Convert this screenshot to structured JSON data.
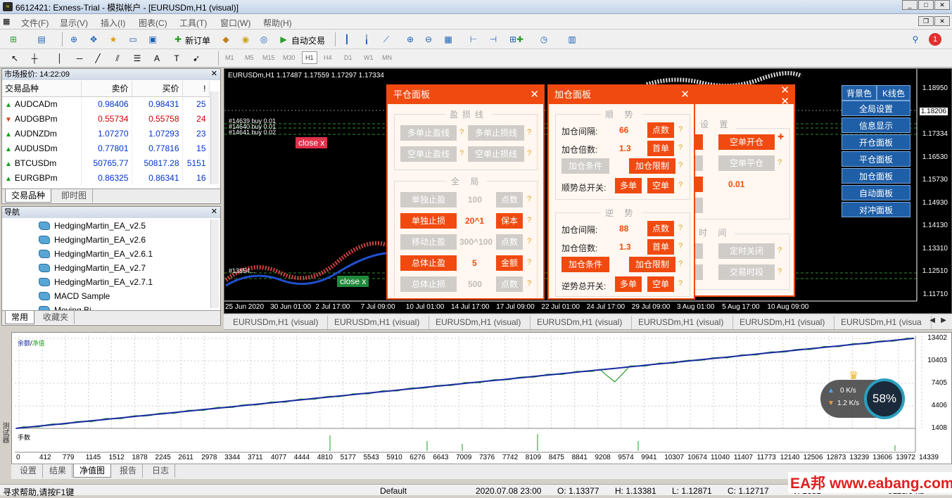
{
  "window": {
    "title": "6612421: Exness-Trial - 模拟帐户 - [EURUSDm,H1 (visual)]"
  },
  "menu": [
    "文件(F)",
    "显示(V)",
    "插入(I)",
    "图表(C)",
    "工具(T)",
    "窗口(W)",
    "帮助(H)"
  ],
  "toolbar": {
    "new_order": "新订单",
    "auto_trade": "自动交易",
    "timeframes": [
      "M1",
      "M5",
      "M15",
      "M30",
      "H1",
      "H4",
      "D1",
      "W1",
      "MN"
    ],
    "active_tf": "H1",
    "notif_count": "1"
  },
  "market_watch": {
    "title": "市场报价: 14:22:09",
    "cols": [
      "交易品种",
      "卖价",
      "买价",
      "!"
    ],
    "rows": [
      {
        "sym": "AUDCADm",
        "bid": "0.98406",
        "ask": "0.98431",
        "sp": "25",
        "color": "#0033cc",
        "dir": "up"
      },
      {
        "sym": "AUDGBPm",
        "bid": "0.55734",
        "ask": "0.55758",
        "sp": "24",
        "color": "#cc0000",
        "dir": "down"
      },
      {
        "sym": "AUDNZDm",
        "bid": "1.07270",
        "ask": "1.07293",
        "sp": "23",
        "color": "#0033cc",
        "dir": "up"
      },
      {
        "sym": "AUDUSDm",
        "bid": "0.77801",
        "ask": "0.77816",
        "sp": "15",
        "color": "#0033cc",
        "dir": "up"
      },
      {
        "sym": "BTCUSDm",
        "bid": "50765.77",
        "ask": "50817.28",
        "sp": "5151",
        "color": "#0033cc",
        "dir": "up"
      },
      {
        "sym": "EURGBPm",
        "bid": "0.86325",
        "ask": "0.86341",
        "sp": "16",
        "color": "#0033cc",
        "dir": "up"
      }
    ],
    "tabs": [
      "交易品种",
      "即时图"
    ]
  },
  "navigator": {
    "title": "导航",
    "items": [
      "HedgingMartin_EA_v2.5",
      "HedgingMartin_EA_v2.6",
      "HedgingMartin_EA_v2.6.1",
      "HedgingMartin_EA_v2.7",
      "HedgingMartin_EA_v2.7.1",
      "MACD Sample",
      "Moving Bi..."
    ],
    "tabs": [
      "常用",
      "收藏夹"
    ]
  },
  "chart": {
    "symbol": "EURUSDm,H1  1.17487 1.17559 1.17297 1.17334",
    "prices": [
      "1.18950",
      "1.18206",
      "1.17334",
      "1.16530",
      "1.15730",
      "1.14930",
      "1.14130",
      "1.13310",
      "1.12510",
      "1.11710"
    ],
    "times": [
      "25 Jun 2020",
      "30 Jun 01:00",
      "2 Jul 17:00",
      "7 Jul 09:00",
      "10 Jul 01:00",
      "14 Jul 17:00",
      "17 Jul 09:00",
      "22 Jul 01:00",
      "24 Jul 17:00",
      "29 Jul 09:00",
      "3 Aug 01:00",
      "5 Aug 17:00",
      "10 Aug 09:00"
    ],
    "order_labels": [
      "#14639 buy 0.01",
      "#14640 buy 0.01",
      "#14641 buy 0.02",
      "#13854..."
    ],
    "close_red": "close x",
    "close_green": "close x"
  },
  "close_panel": {
    "title": "平仓面板",
    "sec_pl": "盈损线",
    "b1": "多单止盈线",
    "b2": "多单止损线",
    "b3": "空单止盈线",
    "b4": "空单止损线",
    "sec_global": "全 局",
    "r1": {
      "btn": "单独止盈",
      "val": "100",
      "unit": "点数"
    },
    "r2": {
      "btn": "单独止损",
      "val": "20^1",
      "unit": "保本"
    },
    "r3": {
      "btn": "移动止盈",
      "val": "300^100",
      "unit": "点数"
    },
    "r4": {
      "btn": "总体止盈",
      "val": "5",
      "unit": "金额"
    },
    "r5": {
      "btn": "总体止损",
      "val": "500",
      "unit": "点数"
    }
  },
  "add_panel": {
    "title": "加仓面板",
    "sec_trend": "顺 势",
    "sec_counter": "逆 势",
    "t_interval": "加仓间隔:",
    "t_interval_val": "66",
    "t_mult": "加仓倍数:",
    "t_mult_val": "1.3",
    "t_cond": "加仓条件",
    "t_limit": "加仓限制",
    "t_switch": "顺势总开关:",
    "c_interval": "加仓间隔:",
    "c_interval_val": "88",
    "c_mult": "加仓倍数:",
    "c_mult_val": "1.3",
    "c_cond": "加仓条件",
    "c_limit": "加仓限制",
    "c_switch": "逆势总开关:",
    "pts": "点数",
    "first": "首单",
    "long": "多单",
    "short": "空单"
  },
  "third_panel": {
    "sec_set": "设 置",
    "short_open": "空单开仓",
    "short_close": "空单平仓",
    "lot": "0.01",
    "sec_time": "时 间",
    "timed_close": "定时关闭",
    "trade_hours": "交易时段"
  },
  "right_menu": {
    "bg": "背景色",
    "kline": "K线色",
    "items": [
      "全局设置",
      "信息显示",
      "开仓面板",
      "平仓面板",
      "加仓面板",
      "自动面板",
      "对冲面板"
    ]
  },
  "chart_tabs": [
    "EURUSDm,H1 (visual)",
    "EURUSDm,H1 (visual)",
    "EURUSDm,H1 (visual)",
    "EURUSDm,H1 (visual)",
    "EURUSDm,H1 (visual)",
    "EURUSDm,H1 (visual)",
    "EURUSDm,H1 (visua"
  ],
  "tester": {
    "legend_a": "余额",
    "legend_sep": "/",
    "legend_b": "净值",
    "vol_label": "手数",
    "y": [
      "13402",
      "10403",
      "7405",
      "4406",
      "1408"
    ],
    "x": [
      "0",
      "412",
      "779",
      "1145",
      "1512",
      "1878",
      "2245",
      "2611",
      "2978",
      "3344",
      "3711",
      "4077",
      "4444",
      "4810",
      "5177",
      "5543",
      "5910",
      "6276",
      "6643",
      "7009",
      "7376",
      "7742",
      "8109",
      "8475",
      "8841",
      "9208",
      "9574",
      "9941",
      "10307",
      "10674",
      "11040",
      "11407",
      "11773",
      "12140",
      "12506",
      "12873",
      "13239",
      "13606",
      "13972",
      "14339"
    ],
    "side": "测试器",
    "tabs": [
      "设置",
      "结果",
      "净值图",
      "报告",
      "日志"
    ],
    "active": "净值图"
  },
  "speed": {
    "up": "0 K/s",
    "down": "1.2 K/s",
    "pct": "58%"
  },
  "status": {
    "help": "寻求帮助,请按F1键",
    "profile": "Default",
    "time": "2020.07.08 23:00",
    "o": "O: 1.13377",
    "h": "H: 1.13381",
    "l": "L: 1.12871",
    "c": "C: 1.12717",
    "v": "V: 1631",
    "kb": "9118/9 kb"
  },
  "watermark": "EA邦 www.eabang.com",
  "chart_data": {
    "type": "line",
    "series": [
      {
        "name": "余额",
        "values": [
          1408,
          13402
        ]
      },
      {
        "name": "净值",
        "values": [
          1408,
          13402
        ]
      }
    ],
    "ylim": [
      1408,
      13402
    ]
  }
}
